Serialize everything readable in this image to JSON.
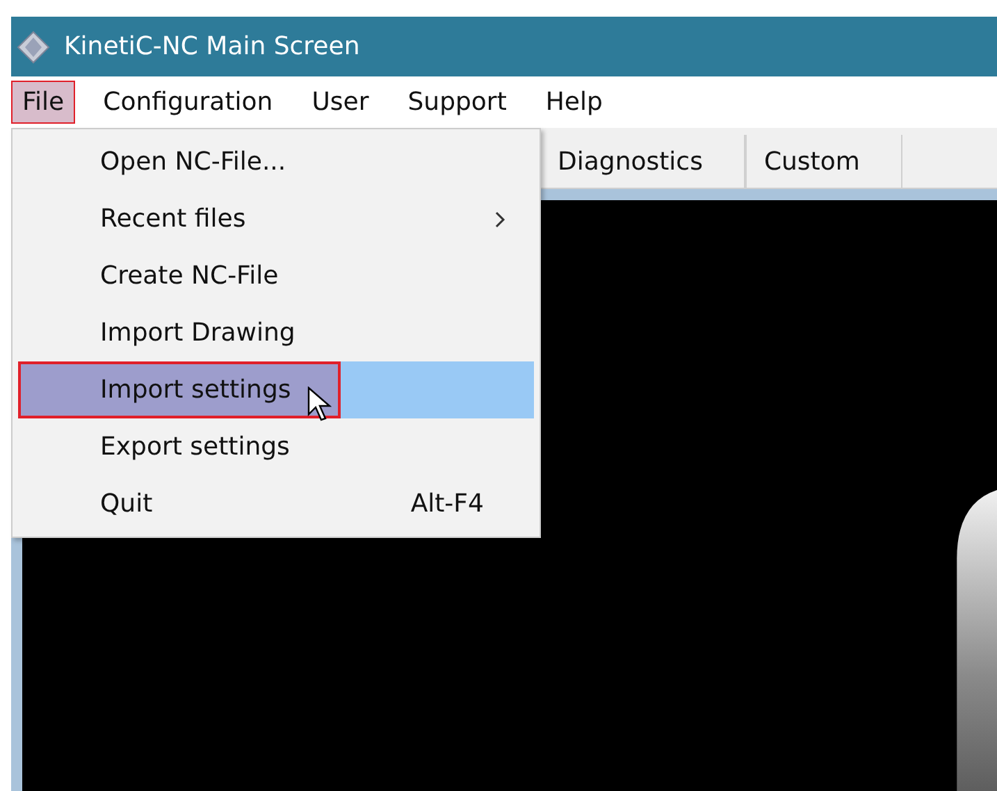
{
  "window": {
    "title": "KinetiC-NC Main Screen"
  },
  "menu_bar": [
    {
      "label": "File",
      "selected": true
    },
    {
      "label": "Configuration",
      "selected": false
    },
    {
      "label": "User",
      "selected": false
    },
    {
      "label": "Support",
      "selected": false
    },
    {
      "label": "Help",
      "selected": false
    }
  ],
  "tabs": [
    {
      "label": "Diagnostics"
    },
    {
      "label": "Custom"
    }
  ],
  "file_menu": [
    {
      "label": "Open NC-File...",
      "selected": false
    },
    {
      "label": "Recent files",
      "submenu": true,
      "selected": false
    },
    {
      "label": "Create NC-File",
      "selected": false
    },
    {
      "label": "Import Drawing",
      "selected": false
    },
    {
      "label": "Import settings",
      "selected": true
    },
    {
      "label": "Export settings",
      "selected": false
    },
    {
      "label": "Quit",
      "shortcut": "Alt-F4",
      "selected": false
    }
  ]
}
